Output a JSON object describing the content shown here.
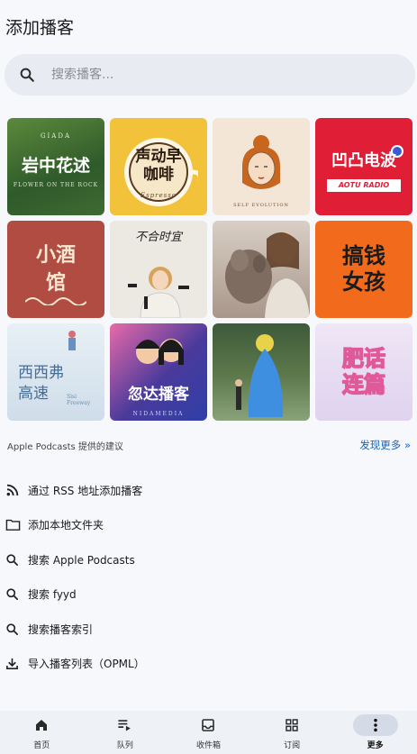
{
  "header": {
    "title": "添加播客"
  },
  "search": {
    "placeholder": "搜索播客..."
  },
  "podcasts": [
    {
      "title": "岩中花述",
      "brand": "GIADA",
      "subtitle": "FLOWER ON THE ROCK",
      "bg": "#3f6b32",
      "fg": "#ffffff"
    },
    {
      "title": "声动早咖啡",
      "subtitle": "Espresso",
      "bg": "#f2c23a",
      "fg": "#2b1a10"
    },
    {
      "title": "",
      "subtitle": "SELF EVOLUTION",
      "bg": "#f3e6d6",
      "fg": "#6b4a2e"
    },
    {
      "title": "凹凸电波",
      "subtitle": "AOTU RADIO",
      "bg": "#e01e36",
      "fg": "#ffffff"
    },
    {
      "title": "小酒馆",
      "bg": "#b14c43",
      "fg": "#f5e7d0"
    },
    {
      "title": "不合时宜",
      "bg": "#ece8e2",
      "fg": "#222222"
    },
    {
      "title": "",
      "bg": "#b8a89a",
      "fg": "#ffffff"
    },
    {
      "title": "搞钱女孩",
      "bg": "#f26a1b",
      "fg": "#1b1b1b"
    },
    {
      "title": "西西弗高速",
      "subtitle": "Sisi Freeway",
      "bg": "#dbe6ef",
      "fg": "#4a6d94"
    },
    {
      "title": "忽达播客",
      "subtitle": "NIDAMEDIA",
      "bg": "#4a3a9c",
      "fg": "#ffffff"
    },
    {
      "title": "",
      "bg": "#4e6a42",
      "fg": "#ffffff"
    },
    {
      "title": "肥话连篇",
      "bg": "#e7dff2",
      "fg": "#ffffff"
    }
  ],
  "suggestions": {
    "label": "Apple Podcasts 提供的建议",
    "link": "发现更多 »"
  },
  "actions": [
    {
      "icon": "rss-icon",
      "label": "通过 RSS 地址添加播客"
    },
    {
      "icon": "folder-icon",
      "label": "添加本地文件夹"
    },
    {
      "icon": "search-icon",
      "label": "搜索 Apple Podcasts"
    },
    {
      "icon": "search-icon",
      "label": "搜索 fyyd"
    },
    {
      "icon": "search-icon",
      "label": "搜索播客索引"
    },
    {
      "icon": "download-icon",
      "label": "导入播客列表（OPML）"
    }
  ],
  "nav": [
    {
      "icon": "home-icon",
      "label": "首页",
      "active": false
    },
    {
      "icon": "queue-icon",
      "label": "队列",
      "active": false
    },
    {
      "icon": "inbox-icon",
      "label": "收件箱",
      "active": false
    },
    {
      "icon": "grid-icon",
      "label": "订阅",
      "active": false
    },
    {
      "icon": "more-vert-icon",
      "label": "更多",
      "active": true
    }
  ],
  "colors": {
    "accent": "#1565c0",
    "background": "#f6f8fc",
    "search_bg": "#e8ebf1",
    "nav_bg": "#eef1f6"
  }
}
